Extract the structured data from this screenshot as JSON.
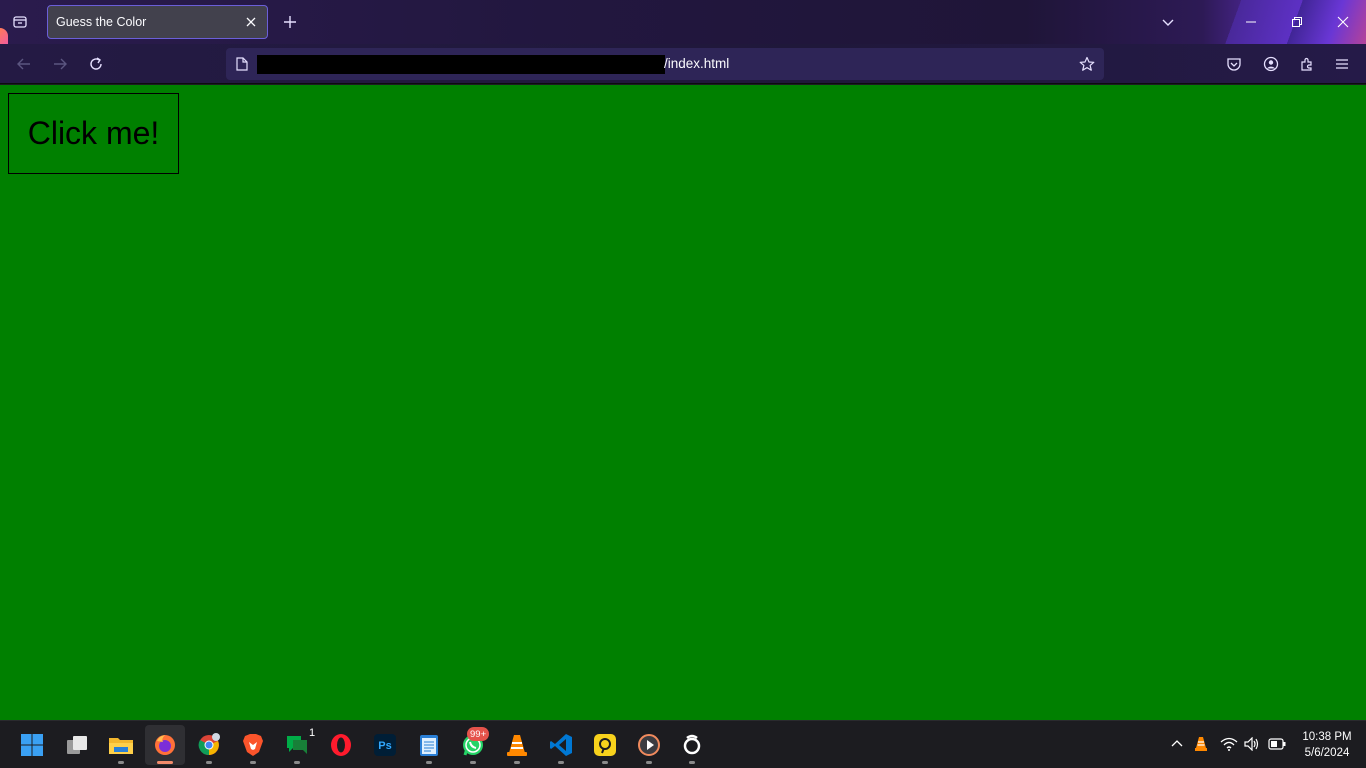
{
  "browser": {
    "tab": {
      "title": "Guess the Color"
    },
    "url": {
      "visible_text": "/index.html"
    }
  },
  "page": {
    "background_color": "#008000",
    "button_label": "Click me!"
  },
  "taskbar": {
    "apps": [
      {
        "name": "start-icon"
      },
      {
        "name": "task-view-icon"
      },
      {
        "name": "file-explorer-icon"
      },
      {
        "name": "firefox-icon",
        "active": true
      },
      {
        "name": "chrome-icon"
      },
      {
        "name": "brave-icon"
      },
      {
        "name": "google-chat-icon",
        "badge": "1"
      },
      {
        "name": "opera-icon"
      },
      {
        "name": "photoshop-icon",
        "label": "Ps"
      },
      {
        "name": "notepad-icon"
      },
      {
        "name": "whatsapp-icon",
        "badge": "99+"
      },
      {
        "name": "vlc-icon"
      },
      {
        "name": "vscode-icon"
      },
      {
        "name": "anydesk-icon"
      },
      {
        "name": "media-player-icon"
      },
      {
        "name": "obs-icon"
      }
    ],
    "clock": {
      "time": "10:38 PM",
      "date": "5/6/2024"
    }
  }
}
